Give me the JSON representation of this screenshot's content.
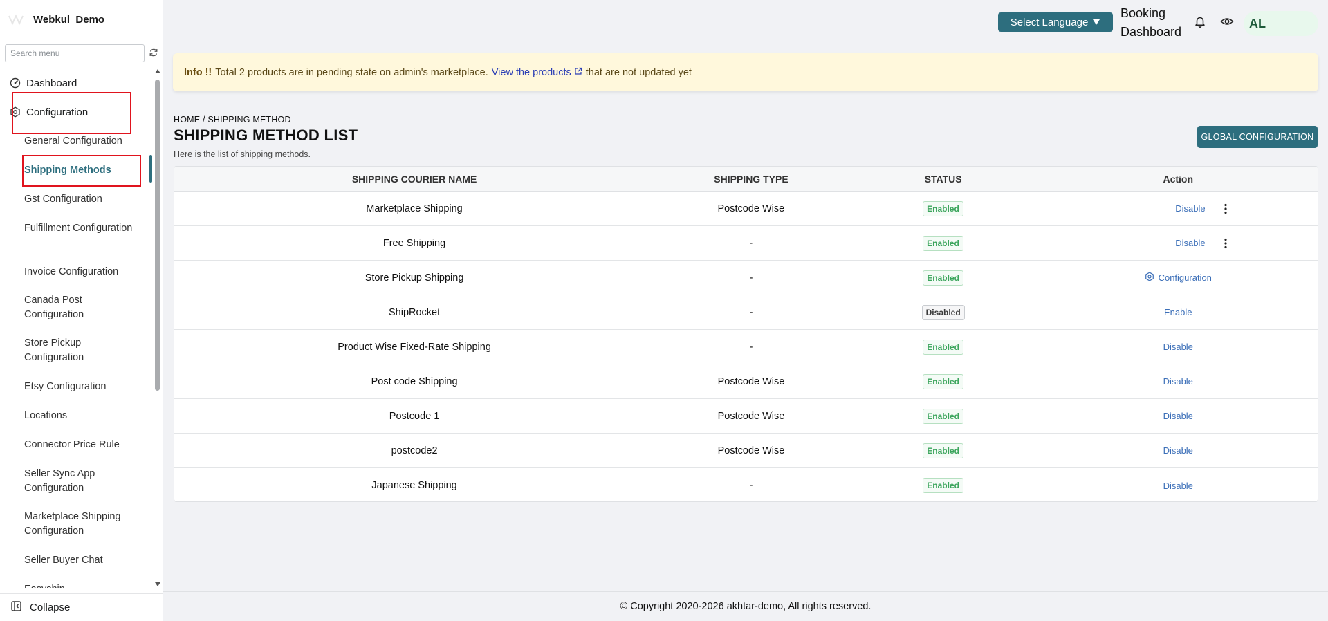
{
  "brand": {
    "name": "Webkul_Demo"
  },
  "search": {
    "placeholder": "Search menu"
  },
  "menu": {
    "top_items": [
      {
        "label": "Dashboard",
        "icon": "dashboard-icon"
      },
      {
        "label": "Configuration",
        "icon": "settings-hex-icon"
      }
    ],
    "sub_items": [
      {
        "label": "General Configuration"
      },
      {
        "label": "Shipping Methods"
      },
      {
        "label": "Gst Configuration"
      },
      {
        "label": "Fulfillment Configuration"
      },
      {
        "label": "Invoice Configuration"
      },
      {
        "label": "Canada Post Configuration"
      },
      {
        "label": "Store Pickup Configuration"
      },
      {
        "label": "Etsy Configuration"
      },
      {
        "label": "Locations"
      },
      {
        "label": "Connector Price Rule"
      },
      {
        "label": "Seller Sync App Configuration"
      },
      {
        "label": "Marketplace Shipping Configuration"
      },
      {
        "label": "Seller Buyer Chat"
      },
      {
        "label": "Easyship"
      }
    ],
    "collapse_label": "Collapse"
  },
  "topbar": {
    "language_label": "Select Language",
    "booking_line1": "Booking",
    "booking_line2": "Dashboard",
    "avatar_initials": "AL"
  },
  "banner": {
    "strong": "Info !!",
    "text": "Total 2 products are in pending state on admin's marketplace.",
    "link": "View the products",
    "suffix": "that are not updated yet"
  },
  "page": {
    "breadcrumb": "HOME / SHIPPING METHOD",
    "title": "SHIPPING METHOD LIST",
    "subtitle": "Here is the list of shipping methods.",
    "global_button": "GLOBAL CONFIGURATION"
  },
  "table": {
    "headers": [
      "SHIPPING COURIER NAME",
      "SHIPPING TYPE",
      "STATUS",
      "Action"
    ],
    "rows": [
      {
        "name": "Marketplace Shipping",
        "type": "Postcode Wise",
        "status": "Enabled",
        "action": "Disable"
      },
      {
        "name": "Free Shipping",
        "type": "-",
        "status": "Enabled",
        "action": "Disable"
      },
      {
        "name": "Store Pickup Shipping",
        "type": "-",
        "status": "Enabled",
        "action": "Configuration"
      },
      {
        "name": "ShipRocket",
        "type": "-",
        "status": "Disabled",
        "action": "Enable"
      },
      {
        "name": "Product Wise Fixed-Rate Shipping",
        "type": "-",
        "status": "Enabled",
        "action": "Disable"
      },
      {
        "name": "Post code Shipping",
        "type": "Postcode Wise",
        "status": "Enabled",
        "action": "Disable"
      },
      {
        "name": "Postcode 1",
        "type": "Postcode Wise",
        "status": "Enabled",
        "action": "Disable"
      },
      {
        "name": "postcode2",
        "type": "Postcode Wise",
        "status": "Enabled",
        "action": "Disable"
      },
      {
        "name": "Japanese Shipping",
        "type": "-",
        "status": "Enabled",
        "action": "Disable"
      }
    ]
  },
  "footer": {
    "text": "© Copyright 2020-2026 akhtar-demo, All rights reserved."
  },
  "colors": {
    "accent": "#2d6e7e",
    "highlight": "#e0141e",
    "enabled": "#3ba55c",
    "link": "#3c6fb8"
  }
}
